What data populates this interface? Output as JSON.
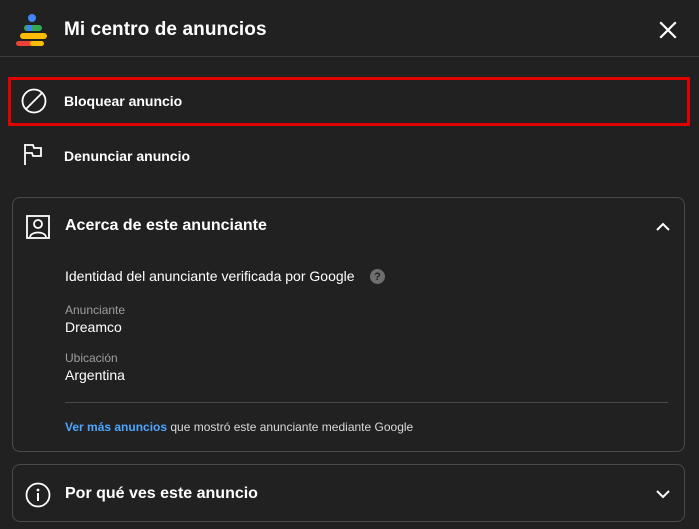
{
  "header": {
    "title": "Mi centro de anuncios",
    "logo": "my-ad-center-logo",
    "close_icon": "close-icon"
  },
  "actions": [
    {
      "label": "Bloquear anuncio",
      "icon": "block-icon",
      "highlighted": true,
      "highlight_color": "#e00000"
    },
    {
      "label": "Denunciar anuncio",
      "icon": "flag-icon"
    }
  ],
  "advertiser_card": {
    "title": "Acerca de este anunciante",
    "icon": "person-icon",
    "expanded": true,
    "verified_text": "Identidad del anunciante verificada por Google",
    "advertiser_label": "Anunciante",
    "advertiser_value": "Dreamco",
    "location_label": "Ubicación",
    "location_value": "Argentina",
    "more_link": "Ver más anuncios",
    "more_text": " que mostró este anunciante mediante Google"
  },
  "why_card": {
    "title": "Por qué ves este anuncio",
    "icon": "info-icon",
    "expanded": false
  },
  "colors": {
    "background": "#212121",
    "link": "#4ea6ff",
    "highlight": "#e00000"
  }
}
